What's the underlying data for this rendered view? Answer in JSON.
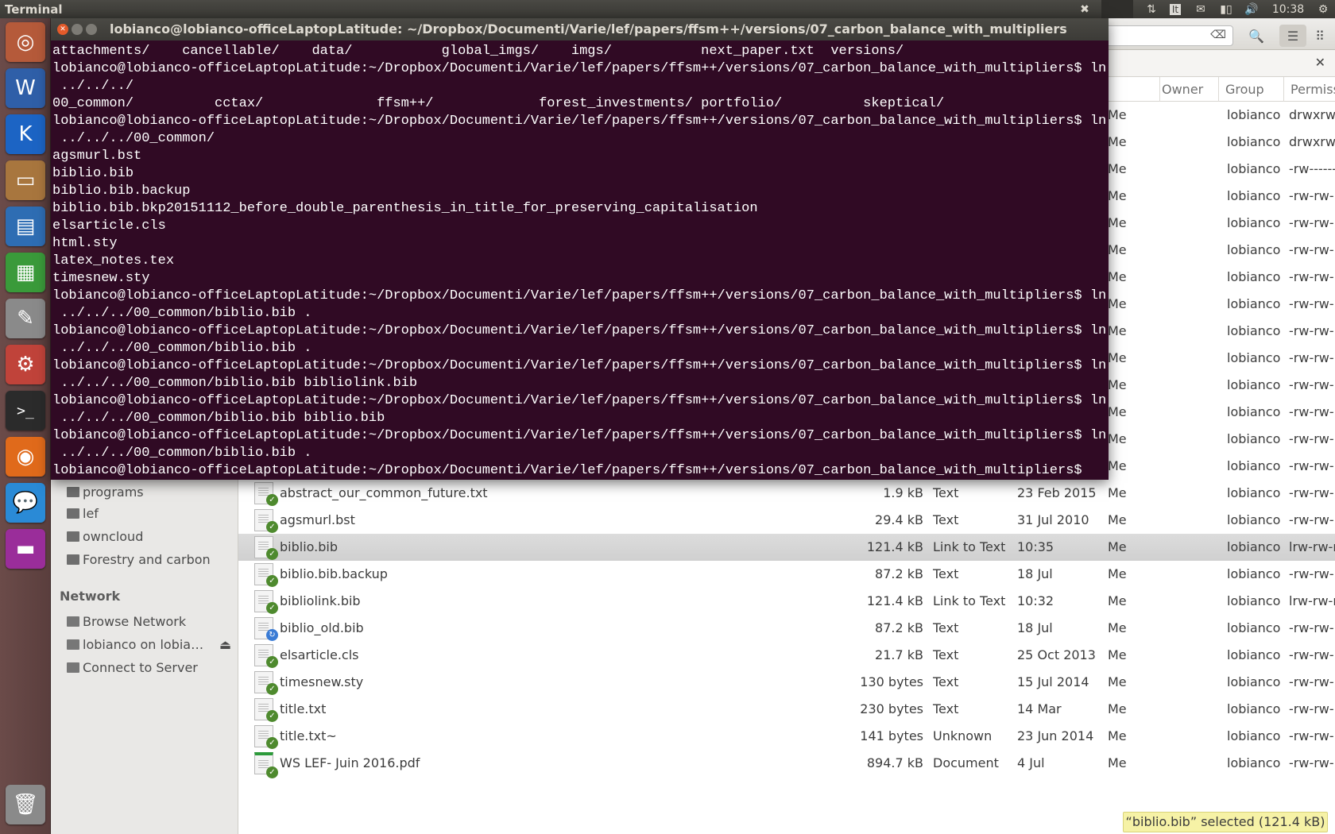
{
  "panel": {
    "app_title": "Terminal",
    "keyboard_layout": "It",
    "clock": "10:38"
  },
  "launcher": {
    "items": [
      {
        "name": "dash",
        "glyph": "◎",
        "color": "#b55a3a"
      },
      {
        "name": "word-processor",
        "glyph": "W",
        "color": "#2f5fa8"
      },
      {
        "name": "kile",
        "glyph": "K",
        "color": "#1c64c4"
      },
      {
        "name": "files",
        "glyph": "▭",
        "color": "#a8763e"
      },
      {
        "name": "libreoffice-writer",
        "glyph": "▤",
        "color": "#2e6db3"
      },
      {
        "name": "libreoffice-calc",
        "glyph": "▦",
        "color": "#3a9a3a"
      },
      {
        "name": "text-editor",
        "glyph": "✎",
        "color": "#8a8a8a"
      },
      {
        "name": "system-settings",
        "glyph": "⚙",
        "color": "#c0433a"
      },
      {
        "name": "terminal",
        "glyph": ">_",
        "color": "#2b2b2b"
      },
      {
        "name": "firefox",
        "glyph": "◉",
        "color": "#e06a1b"
      },
      {
        "name": "empathy",
        "glyph": "💬",
        "color": "#2a8ad6"
      },
      {
        "name": "media-app",
        "glyph": "▬",
        "color": "#9a2d9a"
      }
    ],
    "trash": {
      "name": "trash",
      "glyph": "🗑"
    }
  },
  "terminal": {
    "title": "lobianco@lobianco-officeLaptopLatitude: ~/Dropbox/Documenti/Varie/lef/papers/ffsm++/versions/07_carbon_balance_with_multipliers",
    "lines": [
      "attachments/    cancellable/    data/           global_imgs/    imgs/           next_paper.txt  versions/",
      "lobianco@lobianco-officeLaptopLatitude:~/Dropbox/Documenti/Varie/lef/papers/ffsm++/versions/07_carbon_balance_with_multipliers$ ln -s",
      " ../../../",
      "00_common/          cctax/              ffsm++/             forest_investments/ portfolio/          skeptical/",
      "lobianco@lobianco-officeLaptopLatitude:~/Dropbox/Documenti/Varie/lef/papers/ffsm++/versions/07_carbon_balance_with_multipliers$ ln -s",
      " ../../../00_common/",
      "agsmurl.bst",
      "biblio.bib",
      "biblio.bib.backup",
      "biblio.bib.bkp20151112_before_double_parenthesis_in_title_for_preserving_capitalisation",
      "elsarticle.cls",
      "html.sty",
      "latex_notes.tex",
      "timesnew.sty",
      "lobianco@lobianco-officeLaptopLatitude:~/Dropbox/Documenti/Varie/lef/papers/ffsm++/versions/07_carbon_balance_with_multipliers$ ln -s",
      " ../../../00_common/biblio.bib .",
      "lobianco@lobianco-officeLaptopLatitude:~/Dropbox/Documenti/Varie/lef/papers/ffsm++/versions/07_carbon_balance_with_multipliers$ ln -s",
      " ../../../00_common/biblio.bib .",
      "lobianco@lobianco-officeLaptopLatitude:~/Dropbox/Documenti/Varie/lef/papers/ffsm++/versions/07_carbon_balance_with_multipliers$ ln -s",
      " ../../../00_common/biblio.bib bibliolink.bib",
      "lobianco@lobianco-officeLaptopLatitude:~/Dropbox/Documenti/Varie/lef/papers/ffsm++/versions/07_carbon_balance_with_multipliers$ ln -s",
      " ../../../00_common/biblio.bib biblio.bib",
      "lobianco@lobianco-officeLaptopLatitude:~/Dropbox/Documenti/Varie/lef/papers/ffsm++/versions/07_carbon_balance_with_multipliers$ ln -s",
      " ../../../00_common/biblio.bib .",
      "lobianco@lobianco-officeLaptopLatitude:~/Dropbox/Documenti/Varie/lef/papers/ffsm++/versions/07_carbon_balance_with_multipliers$ "
    ]
  },
  "files": {
    "sidebar": {
      "places": [
        "programs",
        "lef",
        "owncloud",
        "Forestry and carbon"
      ],
      "network_heading": "Network",
      "network": [
        "Browse Network",
        "lobianco on lobia…",
        "Connect to Server"
      ]
    },
    "columns": {
      "owner": "Owner",
      "group": "Group",
      "permissions": "Permissions"
    },
    "rows": [
      {
        "name": "",
        "size": "",
        "type": "",
        "modified": "",
        "owner": "Me",
        "group": "lobianco",
        "perms": "drwxrwxr-x"
      },
      {
        "name": "",
        "size": "",
        "type": "",
        "modified": "",
        "owner": "Me",
        "group": "lobianco",
        "perms": "drwxrwxr-x"
      },
      {
        "name": "",
        "size": "",
        "type": "",
        "modified": "",
        "owner": "Me",
        "group": "lobianco",
        "perms": "-rw-------"
      },
      {
        "name": "",
        "size": "",
        "type": "",
        "modified": "",
        "owner": "Me",
        "group": "lobianco",
        "perms": "-rw-rw-r--"
      },
      {
        "name": "",
        "size": "",
        "type": "",
        "modified": "",
        "owner": "Me",
        "group": "lobianco",
        "perms": "-rw-rw-r--"
      },
      {
        "name": "",
        "size": "",
        "type": "",
        "modified": "",
        "owner": "Me",
        "group": "lobianco",
        "perms": "-rw-rw-r--"
      },
      {
        "name": "",
        "size": "",
        "type": "",
        "modified": "",
        "owner": "Me",
        "group": "lobianco",
        "perms": "-rw-rw-r--"
      },
      {
        "name": "",
        "size": "",
        "type": "",
        "modified": "",
        "owner": "Me",
        "group": "lobianco",
        "perms": "-rw-rw-r--"
      },
      {
        "name": "",
        "size": "",
        "type": "",
        "modified": "",
        "owner": "Me",
        "group": "lobianco",
        "perms": "-rw-rw-r--"
      },
      {
        "name": "",
        "size": "",
        "type": "",
        "modified": "",
        "owner": "Me",
        "group": "lobianco",
        "perms": "-rw-rw-r--"
      },
      {
        "name": "",
        "size": "",
        "type": "",
        "modified": "",
        "owner": "Me",
        "group": "lobianco",
        "perms": "-rw-rw-r--"
      },
      {
        "name": "",
        "size": "",
        "type": "",
        "modified": "",
        "owner": "Me",
        "group": "lobianco",
        "perms": "-rw-rw-r--"
      },
      {
        "name": "",
        "size": "",
        "type": "",
        "modified": "",
        "owner": "Me",
        "group": "lobianco",
        "perms": "-rw-rw-r--"
      },
      {
        "name": "",
        "size": "",
        "type": "",
        "modified": "",
        "owner": "Me",
        "group": "lobianco",
        "perms": "-rw-rw-r--"
      },
      {
        "name": "abstract_our_common_future.txt",
        "size": "1.9 kB",
        "type": "Text",
        "modified": "23 Feb 2015",
        "owner": "Me",
        "group": "lobianco",
        "perms": "-rw-rw-r--"
      },
      {
        "name": "agsmurl.bst",
        "size": "29.4 kB",
        "type": "Text",
        "modified": "31 Jul 2010",
        "owner": "Me",
        "group": "lobianco",
        "perms": "-rw-rw-r--"
      },
      {
        "name": "biblio.bib",
        "size": "121.4 kB",
        "type": "Link to Text",
        "modified": "10:35",
        "owner": "Me",
        "group": "lobianco",
        "perms": "lrw-rw-r--",
        "selected": true
      },
      {
        "name": "biblio.bib.backup",
        "size": "87.2 kB",
        "type": "Text",
        "modified": "18 Jul",
        "owner": "Me",
        "group": "lobianco",
        "perms": "-rw-rw-r--"
      },
      {
        "name": "bibliolink.bib",
        "size": "121.4 kB",
        "type": "Link to Text",
        "modified": "10:32",
        "owner": "Me",
        "group": "lobianco",
        "perms": "lrw-rw-r--"
      },
      {
        "name": "biblio_old.bib",
        "size": "87.2 kB",
        "type": "Text",
        "modified": "18 Jul",
        "owner": "Me",
        "group": "lobianco",
        "perms": "-rw-rw-r--",
        "sync": true
      },
      {
        "name": "elsarticle.cls",
        "size": "21.7 kB",
        "type": "Text",
        "modified": "25 Oct 2013",
        "owner": "Me",
        "group": "lobianco",
        "perms": "-rw-rw-r--"
      },
      {
        "name": "timesnew.sty",
        "size": "130 bytes",
        "type": "Text",
        "modified": "15 Jul 2014",
        "owner": "Me",
        "group": "lobianco",
        "perms": "-rw-rw-r--"
      },
      {
        "name": "title.txt",
        "size": "230 bytes",
        "type": "Text",
        "modified": "14 Mar",
        "owner": "Me",
        "group": "lobianco",
        "perms": "-rw-rw-r--"
      },
      {
        "name": "title.txt~",
        "size": "141 bytes",
        "type": "Unknown",
        "modified": "23 Jun 2014",
        "owner": "Me",
        "group": "lobianco",
        "perms": "-rw-rw-r--"
      },
      {
        "name": "WS LEF- Juin 2016.pdf",
        "size": "894.7 kB",
        "type": "Document",
        "modified": "4 Jul",
        "owner": "Me",
        "group": "lobianco",
        "perms": "-rw-rw-r--"
      }
    ],
    "status": "“biblio.bib” selected (121.4 kB)"
  },
  "colors": {
    "terminal_bg": "#300a24",
    "selection": "#d4d4d4",
    "status_bg": "#f6f2a6",
    "sync_ok": "#4e8a2e"
  }
}
